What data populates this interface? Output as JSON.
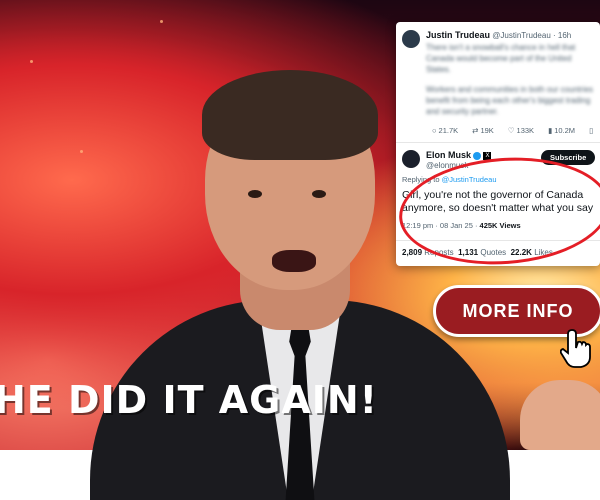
{
  "tweet_original": {
    "name": "Justin Trudeau",
    "handle": "@JustinTrudeau · 16h",
    "text_line1": "There isn't a snowball's chance in hell that Canada would become part of the United States.",
    "text_line2": "Workers and communities in both our countries benefit from being each other's biggest trading and security partner.",
    "replies": "21.7K",
    "reposts": "19K",
    "likes": "133K",
    "views": "10.2M"
  },
  "tweet_reply": {
    "name": "Elon Musk",
    "handle": "@elonmusk",
    "subscribe_label": "Subscribe",
    "replying_prefix": "Replying to",
    "replying_handle": "@JustinTrudeau",
    "text": "Girl, you're not the governor of Canada anymore, so doesn't matter what you say",
    "time": "12:19 pm · 08 Jan 25 · ",
    "views": "425K Views",
    "reposts_count": "2,809",
    "reposts_label": "Reposts",
    "quotes_count": "1,131",
    "quotes_label": "Quotes",
    "likes_count": "22.2K",
    "likes_label": "Likes"
  },
  "cta": {
    "label": "MORE INFO"
  },
  "headline": "HE DID IT AGAIN!",
  "colors": {
    "cta_bg": "#9a1c21",
    "highlight_circle": "#e41e26",
    "link_blue": "#1d9bf0"
  },
  "icons": [
    "reply-icon",
    "repost-icon",
    "like-icon",
    "views-icon",
    "bookmark-icon",
    "verified-icon",
    "x-logo-icon",
    "hand-cursor-icon"
  ]
}
